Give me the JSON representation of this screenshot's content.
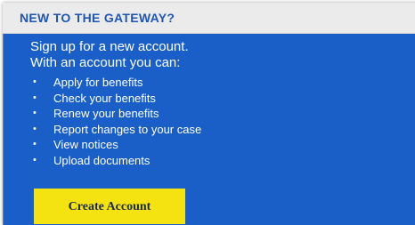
{
  "panel": {
    "title": "NEW TO THE GATEWAY?",
    "intro_line1": "Sign up for a new account.",
    "intro_line2": "With an account you can:",
    "bullets": [
      "Apply for benefits",
      "Check your benefits",
      "Renew your benefits",
      "Report changes to your case",
      "View notices",
      "Upload documents"
    ],
    "button_label": "Create Account"
  },
  "colors": {
    "panel_background": "#1a5fc8",
    "header_background": "#ebebeb",
    "title_text": "#1f55b3",
    "button_background": "#f5e211"
  }
}
